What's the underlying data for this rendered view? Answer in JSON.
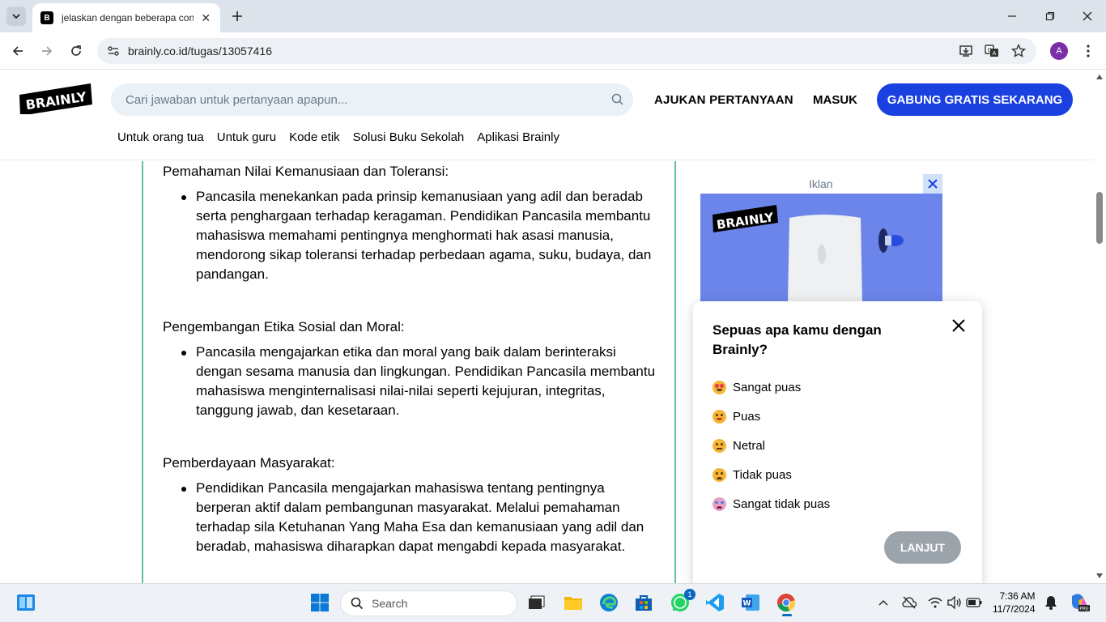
{
  "browser": {
    "tab_title": "jelaskan dengan beberapa cont",
    "tab_favicon": "B",
    "url": "brainly.co.id/tugas/13057416",
    "profile_initial": "A"
  },
  "header": {
    "logo_text": "BRAINLY",
    "search_placeholder": "Cari jawaban untuk pertanyaan apapun...",
    "ask_label": "AJUKAN PERTANYAAN",
    "login_label": "MASUK",
    "join_label": "GABUNG GRATIS SEKARANG",
    "subnav": [
      "Untuk orang tua",
      "Untuk guru",
      "Kode etik",
      "Solusi Buku Sekolah",
      "Aplikasi Brainly"
    ]
  },
  "content": {
    "sections": [
      {
        "heading": "Pemahaman Nilai Kemanusiaan dan Toleransi:",
        "items": [
          "Pancasila menekankan pada prinsip kemanusiaan yang adil dan beradab serta penghargaan terhadap keragaman. Pendidikan Pancasila membantu mahasiswa memahami pentingnya menghormati hak asasi manusia, mendorong sikap toleransi terhadap perbedaan agama, suku, budaya, dan pandangan."
        ]
      },
      {
        "heading": "Pengembangan Etika Sosial dan Moral:",
        "items": [
          "Pancasila mengajarkan etika dan moral yang baik dalam berinteraksi dengan sesama manusia dan lingkungan. Pendidikan Pancasila membantu mahasiswa menginternalisasi nilai-nilai seperti kejujuran, integritas, tanggung jawab, dan kesetaraan."
        ]
      },
      {
        "heading": "Pemberdayaan Masyarakat:",
        "items": [
          "Pendidikan Pancasila mengajarkan mahasiswa tentang pentingnya berperan aktif dalam pembangunan masyarakat. Melalui pemahaman terhadap sila Ketuhanan Yang Maha Esa dan kemanusiaan yang adil dan beradab, mahasiswa diharapkan dapat mengabdi kepada masyarakat."
        ]
      }
    ]
  },
  "ad": {
    "label": "Iklan",
    "logo_text": "BRAINLY"
  },
  "survey": {
    "title": "Sepuas apa kamu dengan Brainly?",
    "options": [
      "Sangat puas",
      "Puas",
      "Netral",
      "Tidak puas",
      "Sangat tidak puas"
    ],
    "next_label": "LANJUT"
  },
  "taskbar": {
    "search_label": "Search",
    "time": "7:36 AM",
    "date": "11/7/2024",
    "whatsapp_badge": "1"
  },
  "colors": {
    "brand_blue": "#1a40e0",
    "content_border": "#60c199",
    "ad_background": "#6c85ea"
  }
}
